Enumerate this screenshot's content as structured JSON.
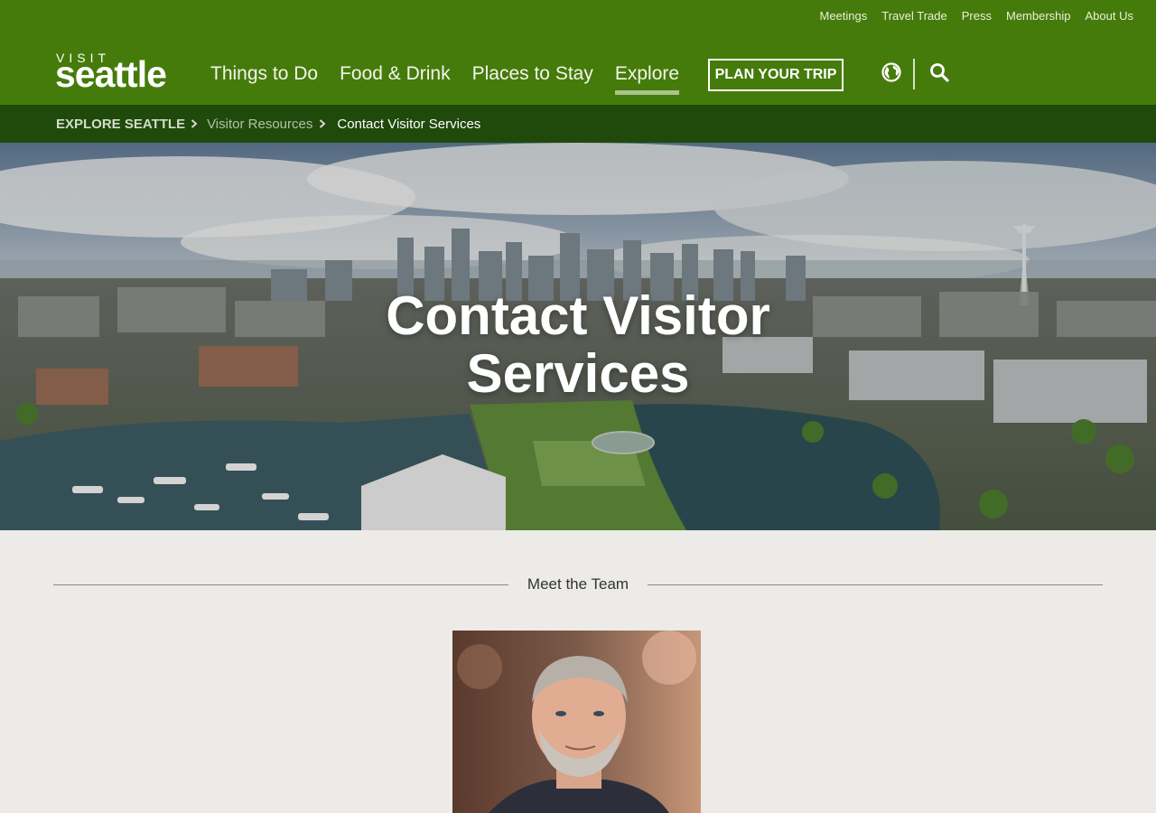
{
  "utility_nav": [
    "Meetings",
    "Travel Trade",
    "Press",
    "Membership",
    "About Us"
  ],
  "logo": {
    "top": "VISIT",
    "main": "seattle"
  },
  "main_nav": [
    {
      "label": "Things to Do"
    },
    {
      "label": "Food & Drink"
    },
    {
      "label": "Places to Stay"
    },
    {
      "label": "Explore",
      "active": true
    }
  ],
  "plan_button": "PLAN YOUR TRIP",
  "icons": {
    "language": "globe-icon",
    "search": "search-icon",
    "breadcrumb_separator": "chevron-right-icon"
  },
  "breadcrumb": [
    "EXPLORE SEATTLE",
    "Visitor Resources",
    "Contact Visitor Services"
  ],
  "hero": {
    "title_line1": "Contact Visitor",
    "title_line2": "Services"
  },
  "section": {
    "heading": "Meet the Team"
  },
  "colors": {
    "header_green": "#457b0b",
    "breadcrumb_green": "#1f4a0c",
    "page_bg": "#ecebe7",
    "active_underline": "#a7c48a"
  }
}
